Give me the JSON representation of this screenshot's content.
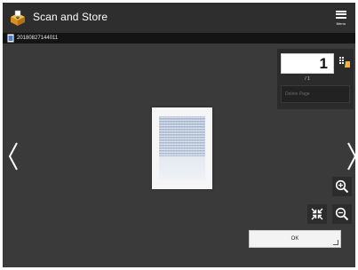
{
  "header": {
    "title": "Scan and Store",
    "menu_label": "Menu"
  },
  "file": {
    "name": "20180827144011"
  },
  "page_control": {
    "current_page": "1",
    "total_text": "/ 1",
    "delete_label": "Delete Page"
  },
  "actions": {
    "ok_label": "OK"
  },
  "colors": {
    "background": "#3a3a3a",
    "header": "#2e2e2e",
    "filebar": "#141414",
    "app_icon": "#e8a62b"
  }
}
